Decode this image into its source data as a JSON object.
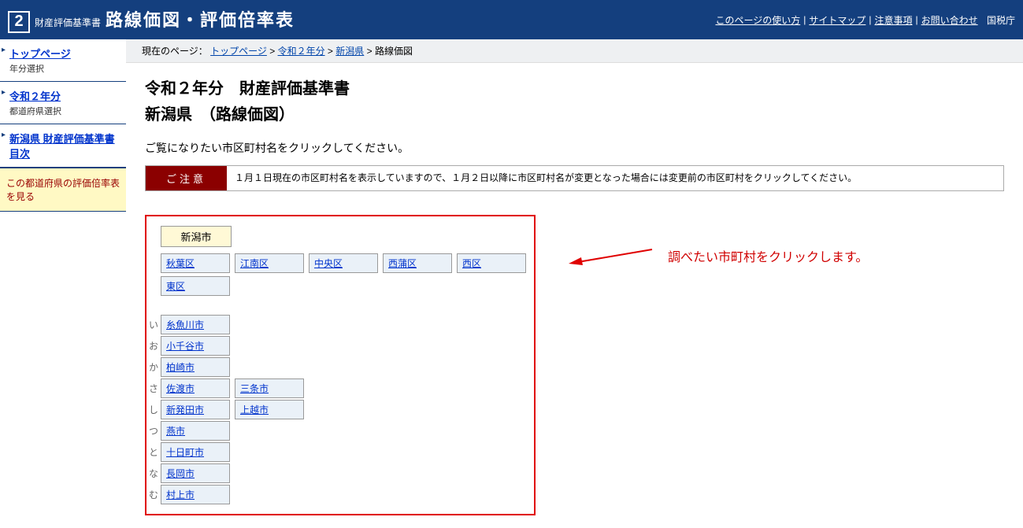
{
  "header": {
    "logo_num": "2",
    "sub": "財産評価基準書",
    "title": "路線価図・評価倍率表",
    "links": {
      "usage": "このページの使い方",
      "sitemap": "サイトマップ",
      "notes": "注意事項",
      "contact": "お問い合わせ",
      "agency": "国税庁"
    }
  },
  "sidebar": {
    "items": [
      {
        "label": "トップページ",
        "sub": "年分選択"
      },
      {
        "label": "令和２年分",
        "sub": "都道府県選択"
      },
      {
        "label": "新潟県 財産評価基準書目次",
        "sub": ""
      }
    ],
    "highlight": "この都道府県の評価倍率表を見る"
  },
  "breadcrumb": {
    "prefix": "現在のページ：",
    "items": [
      "トップページ",
      "令和２年分",
      "新潟県"
    ],
    "current": "路線価図",
    "sep": " > "
  },
  "page": {
    "title1": "令和２年分　財産評価基準書",
    "title2": "新潟県　（路線価図）",
    "instruction": "ご覧になりたい市区町村名をクリックしてください。",
    "notice_label": "ご注意",
    "notice_text": "１月１日現在の市区町村名を表示していますので、１月２日以降に市区町村名が変更となった場合には変更前の市区町村をクリックしてください。"
  },
  "municipalities": {
    "city_header": "新潟市",
    "wards_row1": [
      "秋葉区",
      "江南区",
      "中央区",
      "西蒲区",
      "西区"
    ],
    "wards_row2": [
      "東区"
    ],
    "kana_rows": [
      {
        "kana": "い",
        "cities": [
          "糸魚川市"
        ]
      },
      {
        "kana": "お",
        "cities": [
          "小千谷市"
        ]
      },
      {
        "kana": "か",
        "cities": [
          "柏崎市"
        ]
      },
      {
        "kana": "さ",
        "cities": [
          "佐渡市",
          "三条市"
        ]
      },
      {
        "kana": "し",
        "cities": [
          "新発田市",
          "上越市"
        ]
      },
      {
        "kana": "つ",
        "cities": [
          "燕市"
        ]
      },
      {
        "kana": "と",
        "cities": [
          "十日町市"
        ]
      },
      {
        "kana": "な",
        "cities": [
          "長岡市"
        ]
      },
      {
        "kana": "む",
        "cities": [
          "村上市"
        ]
      }
    ]
  },
  "callout": "調べたい市町村をクリックします。"
}
